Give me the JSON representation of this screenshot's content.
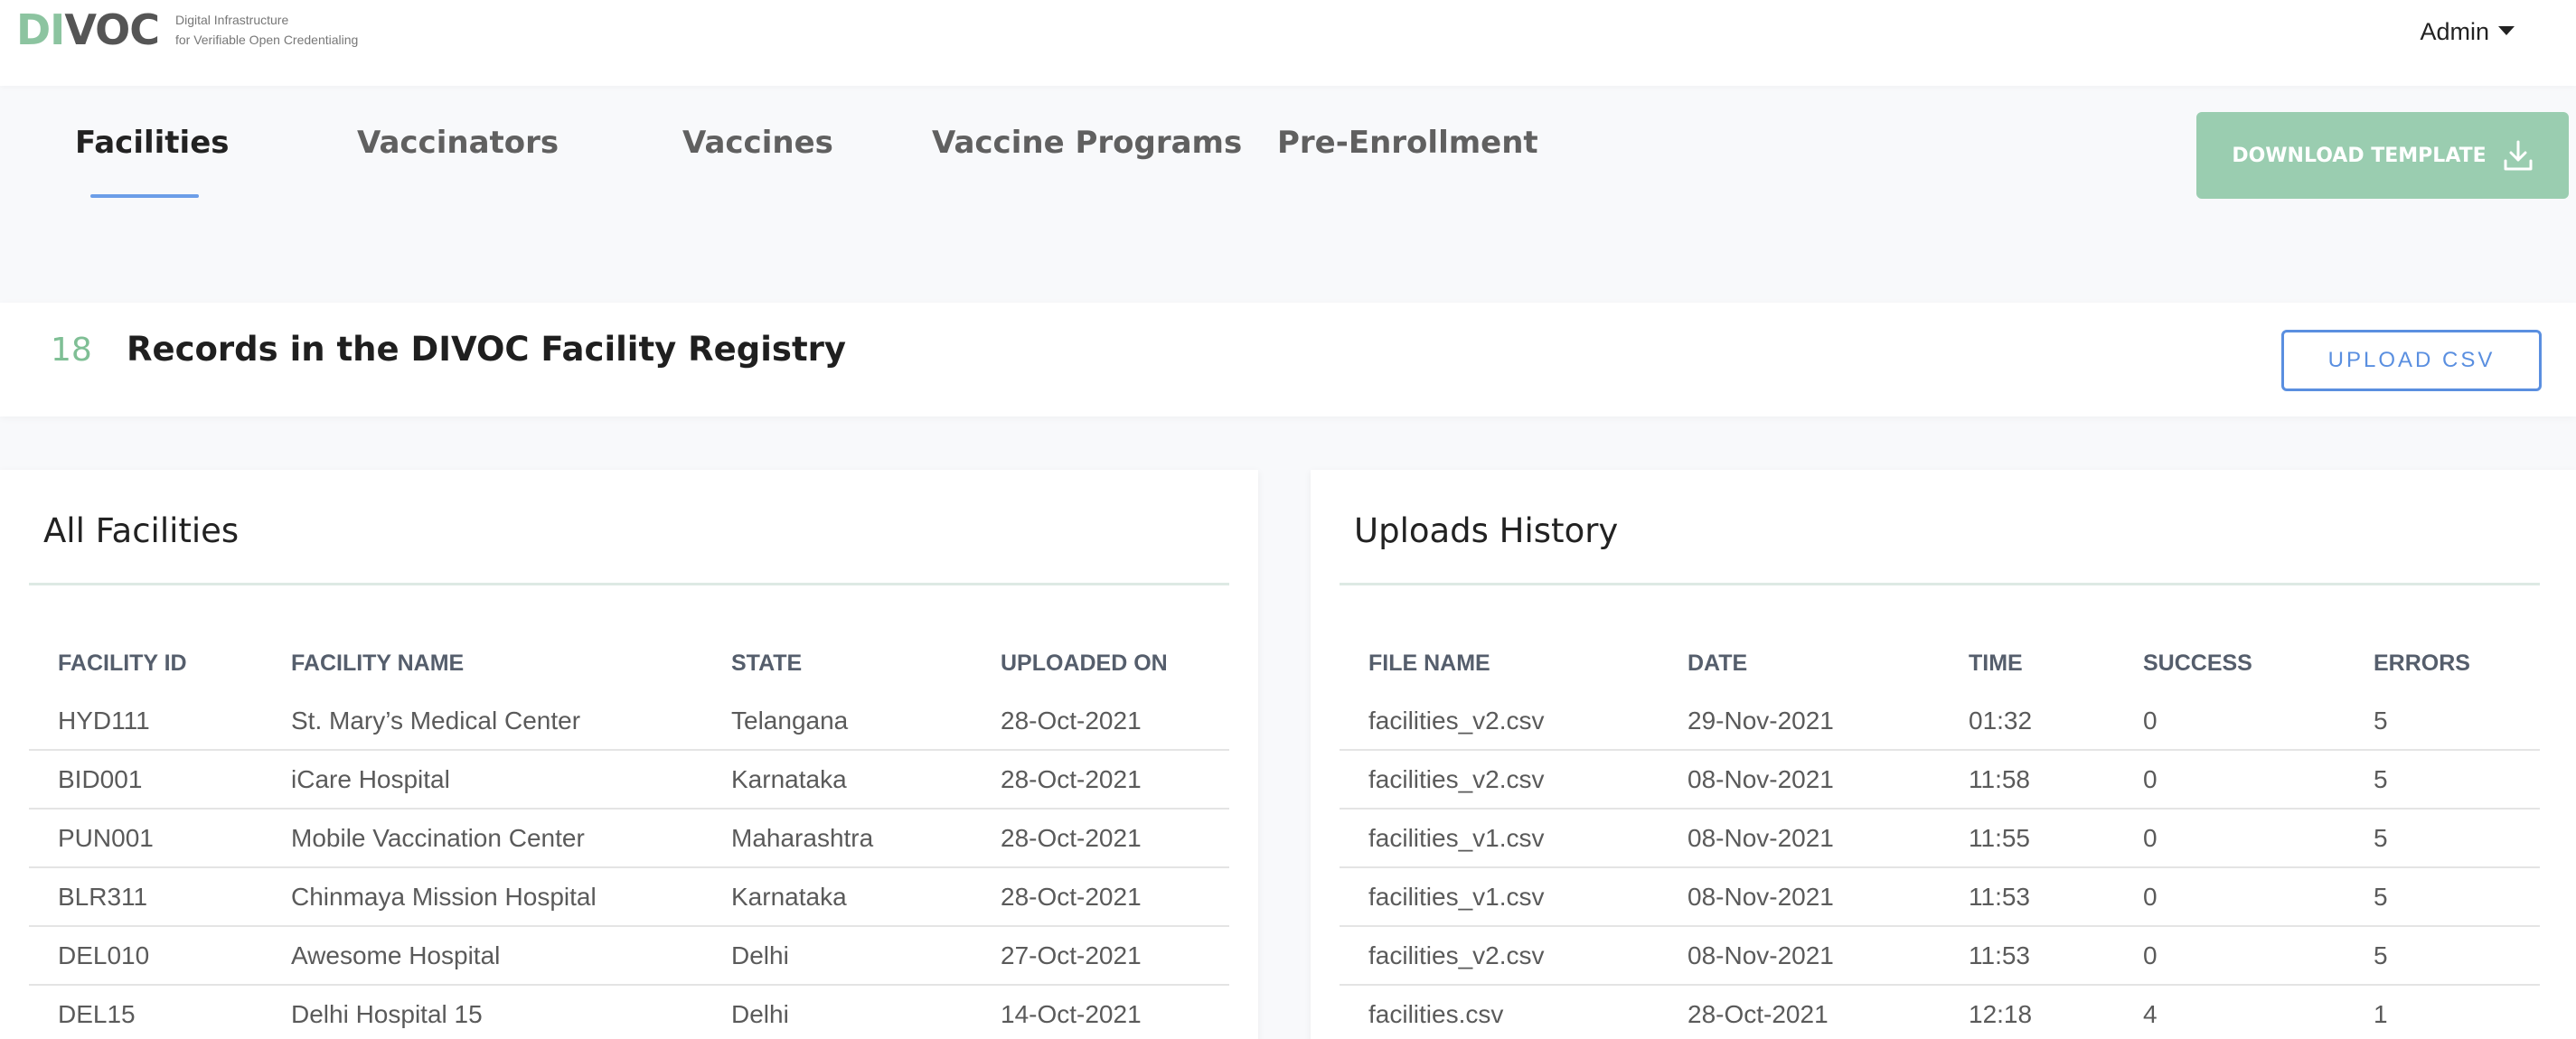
{
  "header": {
    "logo_di": "DI",
    "logo_voc": "VOC",
    "logo_line1": "Digital Infrastructure",
    "logo_line2": "for Verifiable Open Credentialing",
    "user_menu": "Admin"
  },
  "tabs": [
    {
      "label": "Facilities",
      "active": true
    },
    {
      "label": "Vaccinators",
      "active": false
    },
    {
      "label": "Vaccines",
      "active": false
    },
    {
      "label": "Vaccine Programs",
      "active": false
    },
    {
      "label": "Pre-Enrollment",
      "active": false
    }
  ],
  "download_template_label": "DOWNLOAD TEMPLATE",
  "records": {
    "count": "18",
    "label": "Records in the DIVOC Facility Registry",
    "upload_label": "UPLOAD CSV"
  },
  "facilities": {
    "title": "All Facilities",
    "columns": [
      "FACILITY ID",
      "FACILITY NAME",
      "STATE",
      "UPLOADED ON"
    ],
    "rows": [
      [
        "HYD111",
        "St. Mary’s Medical Center",
        "Telangana",
        "28-Oct-2021"
      ],
      [
        "BID001",
        "iCare Hospital",
        "Karnataka",
        "28-Oct-2021"
      ],
      [
        "PUN001",
        "Mobile Vaccination Center",
        "Maharashtra",
        "28-Oct-2021"
      ],
      [
        "BLR311",
        "Chinmaya Mission Hospital",
        "Karnataka",
        "28-Oct-2021"
      ],
      [
        "DEL010",
        "Awesome Hospital",
        "Delhi",
        "27-Oct-2021"
      ],
      [
        "DEL15",
        "Delhi Hospital 15",
        "Delhi",
        "14-Oct-2021"
      ]
    ]
  },
  "uploads": {
    "title": "Uploads History",
    "columns": [
      "FILE NAME",
      "DATE",
      "TIME",
      "SUCCESS",
      "ERRORS"
    ],
    "rows": [
      [
        "facilities_v2.csv",
        "29-Nov-2021",
        "01:32",
        "0",
        "5"
      ],
      [
        "facilities_v2.csv",
        "08-Nov-2021",
        "11:58",
        "0",
        "5"
      ],
      [
        "facilities_v1.csv",
        "08-Nov-2021",
        "11:55",
        "0",
        "5"
      ],
      [
        "facilities_v1.csv",
        "08-Nov-2021",
        "11:53",
        "0",
        "5"
      ],
      [
        "facilities_v2.csv",
        "08-Nov-2021",
        "11:53",
        "0",
        "5"
      ],
      [
        "facilities.csv",
        "28-Oct-2021",
        "12:18",
        "4",
        "1"
      ]
    ]
  },
  "colors": {
    "accent_green": "#9acdb0",
    "accent_blue": "#5a8fe0"
  }
}
